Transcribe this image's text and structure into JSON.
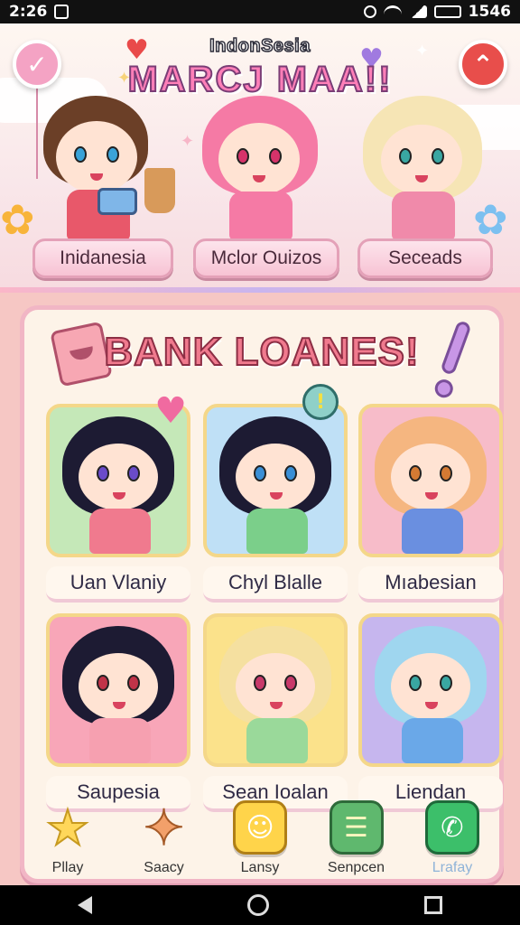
{
  "status_bar": {
    "time": "2:26",
    "battery": "1546"
  },
  "header": {
    "subtitle": "IndonSesia",
    "title": "MARCJ MAA!!"
  },
  "hero_buttons": [
    {
      "label": "Inidanesia"
    },
    {
      "label": "Mclor Ouizos"
    },
    {
      "label": "Seceads"
    }
  ],
  "panel": {
    "title": "BANK LOANES!",
    "cards": [
      {
        "label": "Uan Vlaniy",
        "bg": "#c5e8b8",
        "hair": "#1d1b33",
        "eye": "#6a4bc9",
        "shirt": "#f07a8e"
      },
      {
        "label": "Chyl Blalle",
        "bg": "#bfe0f6",
        "hair": "#1d1b33",
        "eye": "#3a8fd6",
        "shirt": "#7bcf8a"
      },
      {
        "label": "Mıabesian",
        "bg": "#f7bcc9",
        "hair": "#f5b680",
        "eye": "#d47a33",
        "shirt": "#6a8fe0"
      },
      {
        "label": "Saupesia",
        "bg": "#f8a6b8",
        "hair": "#1d1b33",
        "eye": "#c03348",
        "shirt": "#f6a0b0"
      },
      {
        "label": "Sean Ioalan",
        "bg": "#fbe28b",
        "hair": "#f5e0a0",
        "eye": "#c83a6a",
        "shirt": "#9ad99a"
      },
      {
        "label": "Liendan",
        "bg": "#c6b6ee",
        "hair": "#9fd6ef",
        "eye": "#39a7a2",
        "shirt": "#6aa8e8"
      }
    ]
  },
  "bottom_nav": [
    {
      "label": "Pllay",
      "icon": "star-icon",
      "color": "#ffd75a"
    },
    {
      "label": "Saacy",
      "icon": "cookie-icon",
      "color": "#f2a06a"
    },
    {
      "label": "Lansy",
      "icon": "ghost-icon",
      "color": "#ffd44a"
    },
    {
      "label": "Senpcen",
      "icon": "notebook-icon",
      "color": "#5fb86e"
    },
    {
      "label": "Lrafay",
      "icon": "phone-icon",
      "color": "#3cbf6a"
    }
  ]
}
